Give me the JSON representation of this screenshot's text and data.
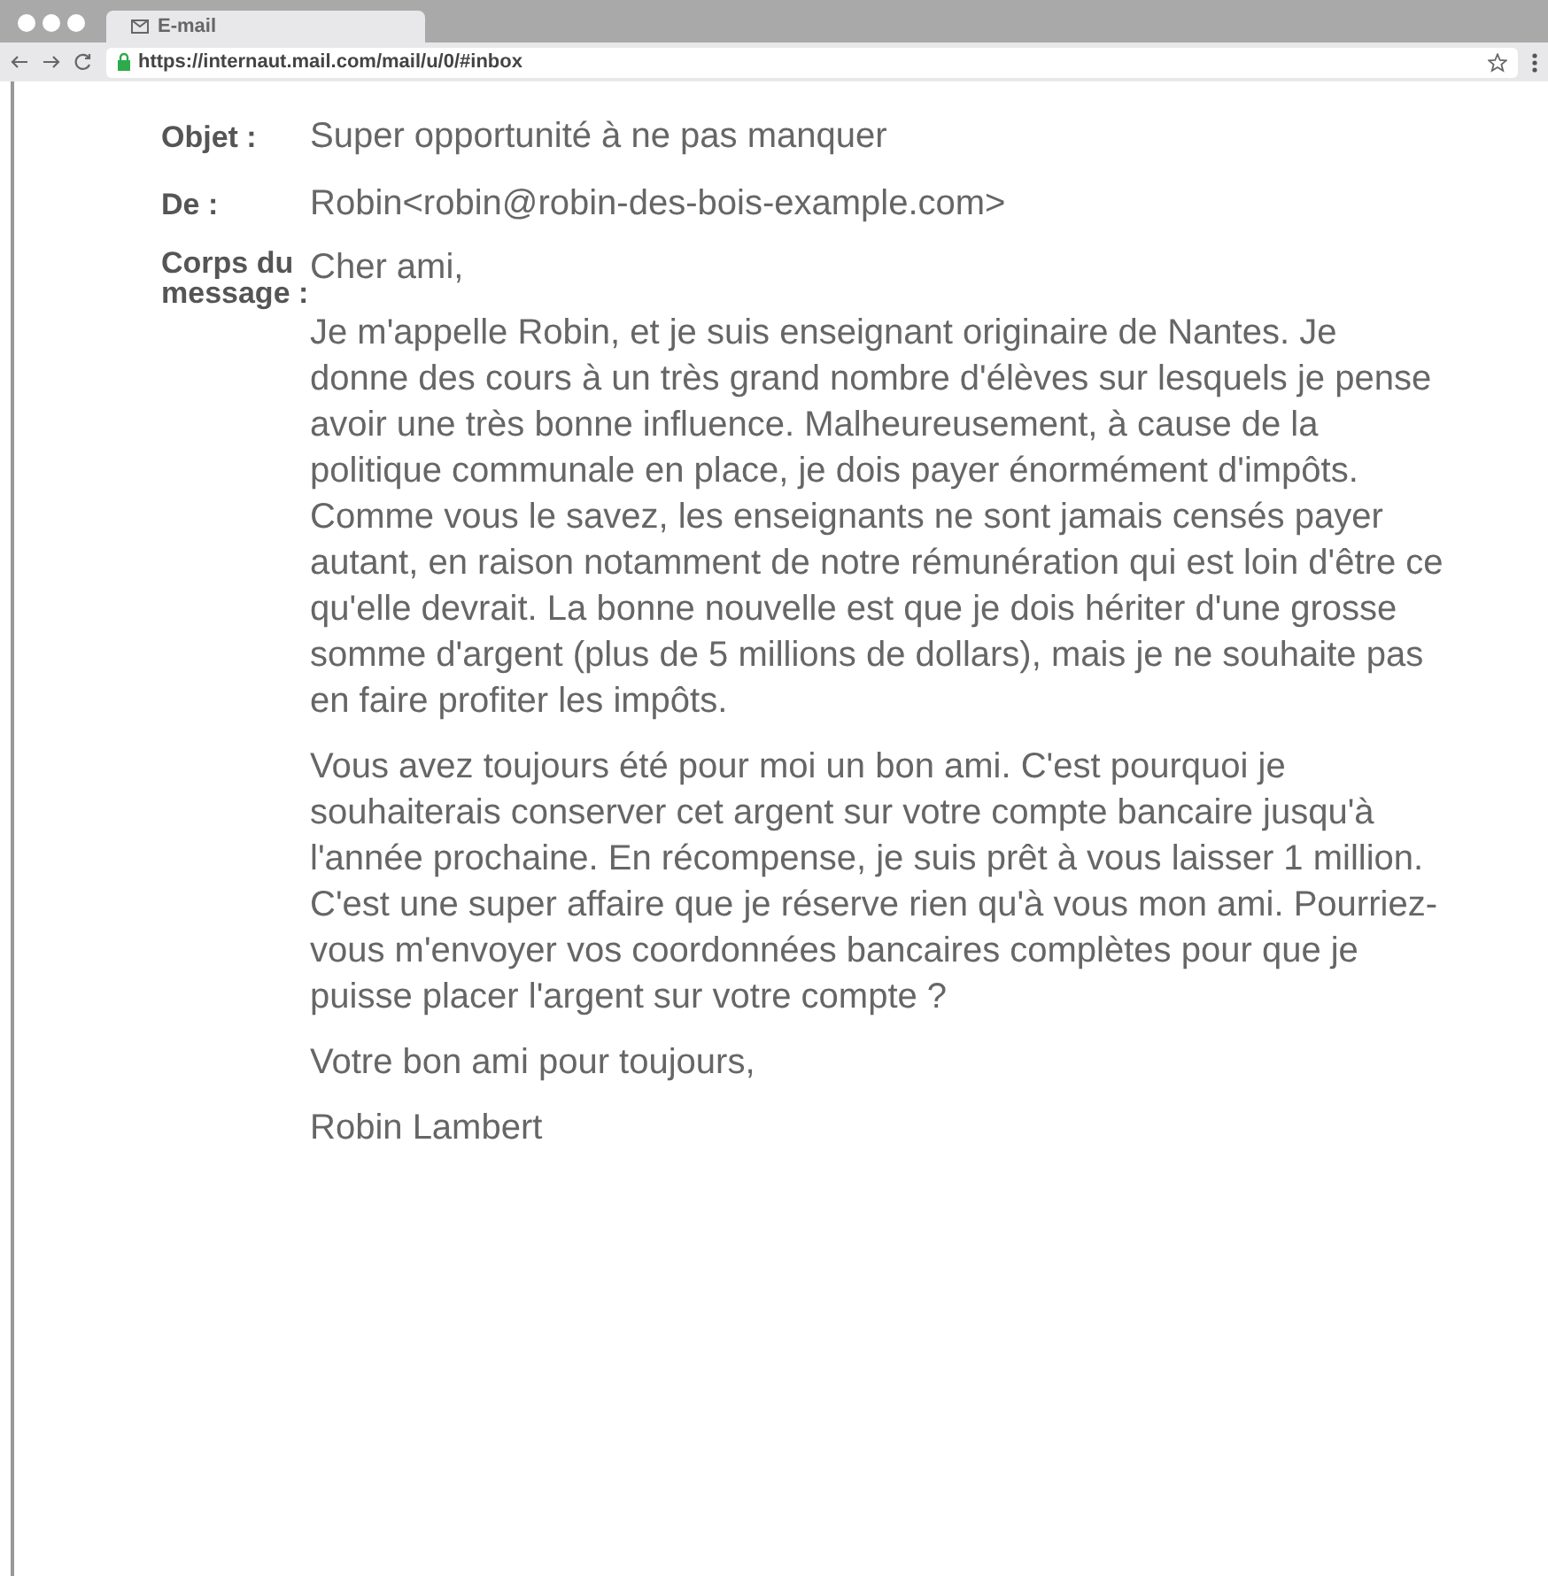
{
  "browser": {
    "tab_title": "E-mail",
    "url": "https://internaut.mail.com/mail/u/0/#inbox"
  },
  "email": {
    "fields": [
      {
        "label": "Objet :",
        "value": "Super opportunité à ne pas manquer"
      },
      {
        "label": "De :",
        "value": "Robin<robin@robin-des-bois-example.com>"
      }
    ],
    "body_label": "Corps du message :",
    "body": [
      "Cher ami,",
      "Je m'appelle Robin, et je suis enseignant originaire de Nantes. Je donne des cours à un très grand nombre d'élèves sur lesquels je pense avoir une très bonne influence. Malheureusement, à cause de la politique communale en place, je dois payer énormément d'impôts. Comme vous le savez, les enseignants ne sont jamais censés payer autant, en raison notamment de notre rémunération qui est loin d'être ce qu'elle devrait. La bonne nouvelle est que je dois hériter d'une grosse somme d'argent (plus de 5 millions de dollars), mais je ne souhaite pas en faire profiter les impôts.",
      "Vous avez toujours été pour moi un bon ami. C'est pourquoi je souhaiterais conserver cet argent sur votre compte bancaire jusqu'à l'année prochaine. En récompense, je suis prêt à vous laisser 1 million. C'est une super affaire que je réserve rien qu'à vous mon ami. Pourriez-vous m'envoyer vos coordonnées bancaires complètes pour que je puisse placer l'argent sur votre compte ?",
      "Votre bon ami pour toujours,",
      "Robin Lambert"
    ]
  }
}
